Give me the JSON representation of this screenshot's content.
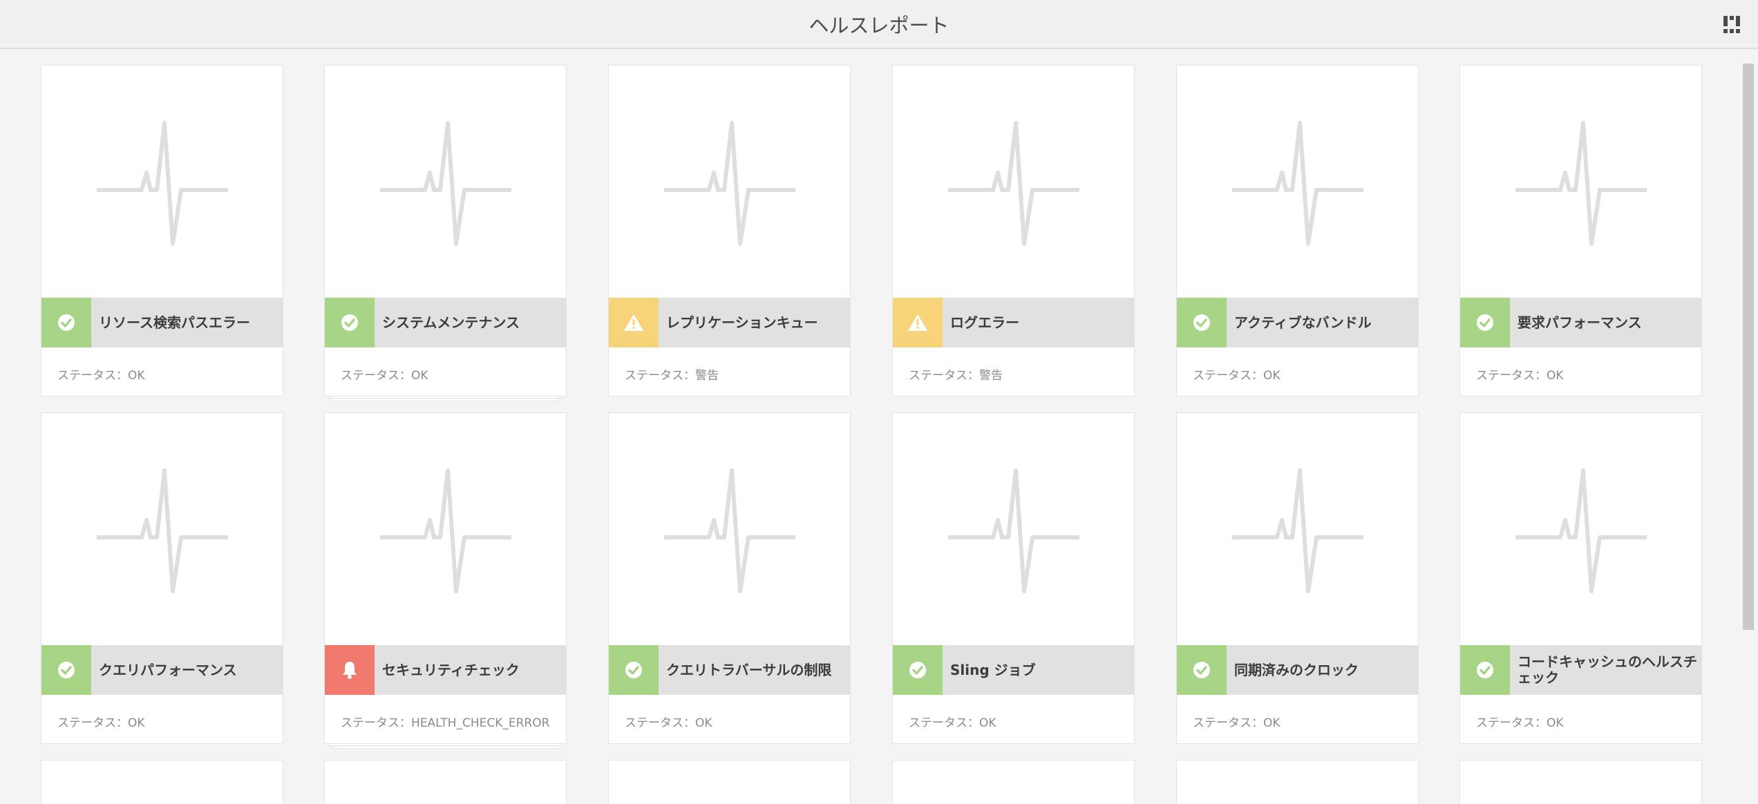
{
  "header": {
    "title": "ヘルスレポート",
    "view_toggle_icon": "grid-view-icon"
  },
  "colors": {
    "ok": "#a8d486",
    "warning": "#f7d37a",
    "error": "#f17a6e",
    "label_bar": "#e1e1e1"
  },
  "cards": [
    {
      "name": "リソース検索パスエラー",
      "status": "ステータス：OK",
      "level": "ok",
      "icon": "check-circle-icon"
    },
    {
      "name": "システムメンテナンス",
      "status": "ステータス：OK",
      "level": "ok",
      "icon": "check-circle-icon"
    },
    {
      "name": "レプリケーションキュー",
      "status": "ステータス：警告",
      "level": "warn",
      "icon": "warning-triangle-icon"
    },
    {
      "name": "ログエラー",
      "status": "ステータス：警告",
      "level": "warn",
      "icon": "warning-triangle-icon"
    },
    {
      "name": "アクティブなバンドル",
      "status": "ステータス：OK",
      "level": "ok",
      "icon": "check-circle-icon"
    },
    {
      "name": "要求パフォーマンス",
      "status": "ステータス：OK",
      "level": "ok",
      "icon": "check-circle-icon"
    },
    {
      "name": "クエリパフォーマンス",
      "status": "ステータス：OK",
      "level": "ok",
      "icon": "check-circle-icon"
    },
    {
      "name": "セキュリティチェック",
      "status": "ステータス：HEALTH_CHECK_ERROR",
      "level": "err",
      "icon": "bell-icon"
    },
    {
      "name": "クエリトラバーサルの制限",
      "status": "ステータス：OK",
      "level": "ok",
      "icon": "check-circle-icon"
    },
    {
      "name": "Sling ジョブ",
      "status": "ステータス：OK",
      "level": "ok",
      "icon": "check-circle-icon"
    },
    {
      "name": "同期済みのクロック",
      "status": "ステータス：OK",
      "level": "ok",
      "icon": "check-circle-icon"
    },
    {
      "name": "コードキャッシュのヘルスチェック",
      "status": "ステータス：OK",
      "level": "ok",
      "icon": "check-circle-icon"
    }
  ]
}
